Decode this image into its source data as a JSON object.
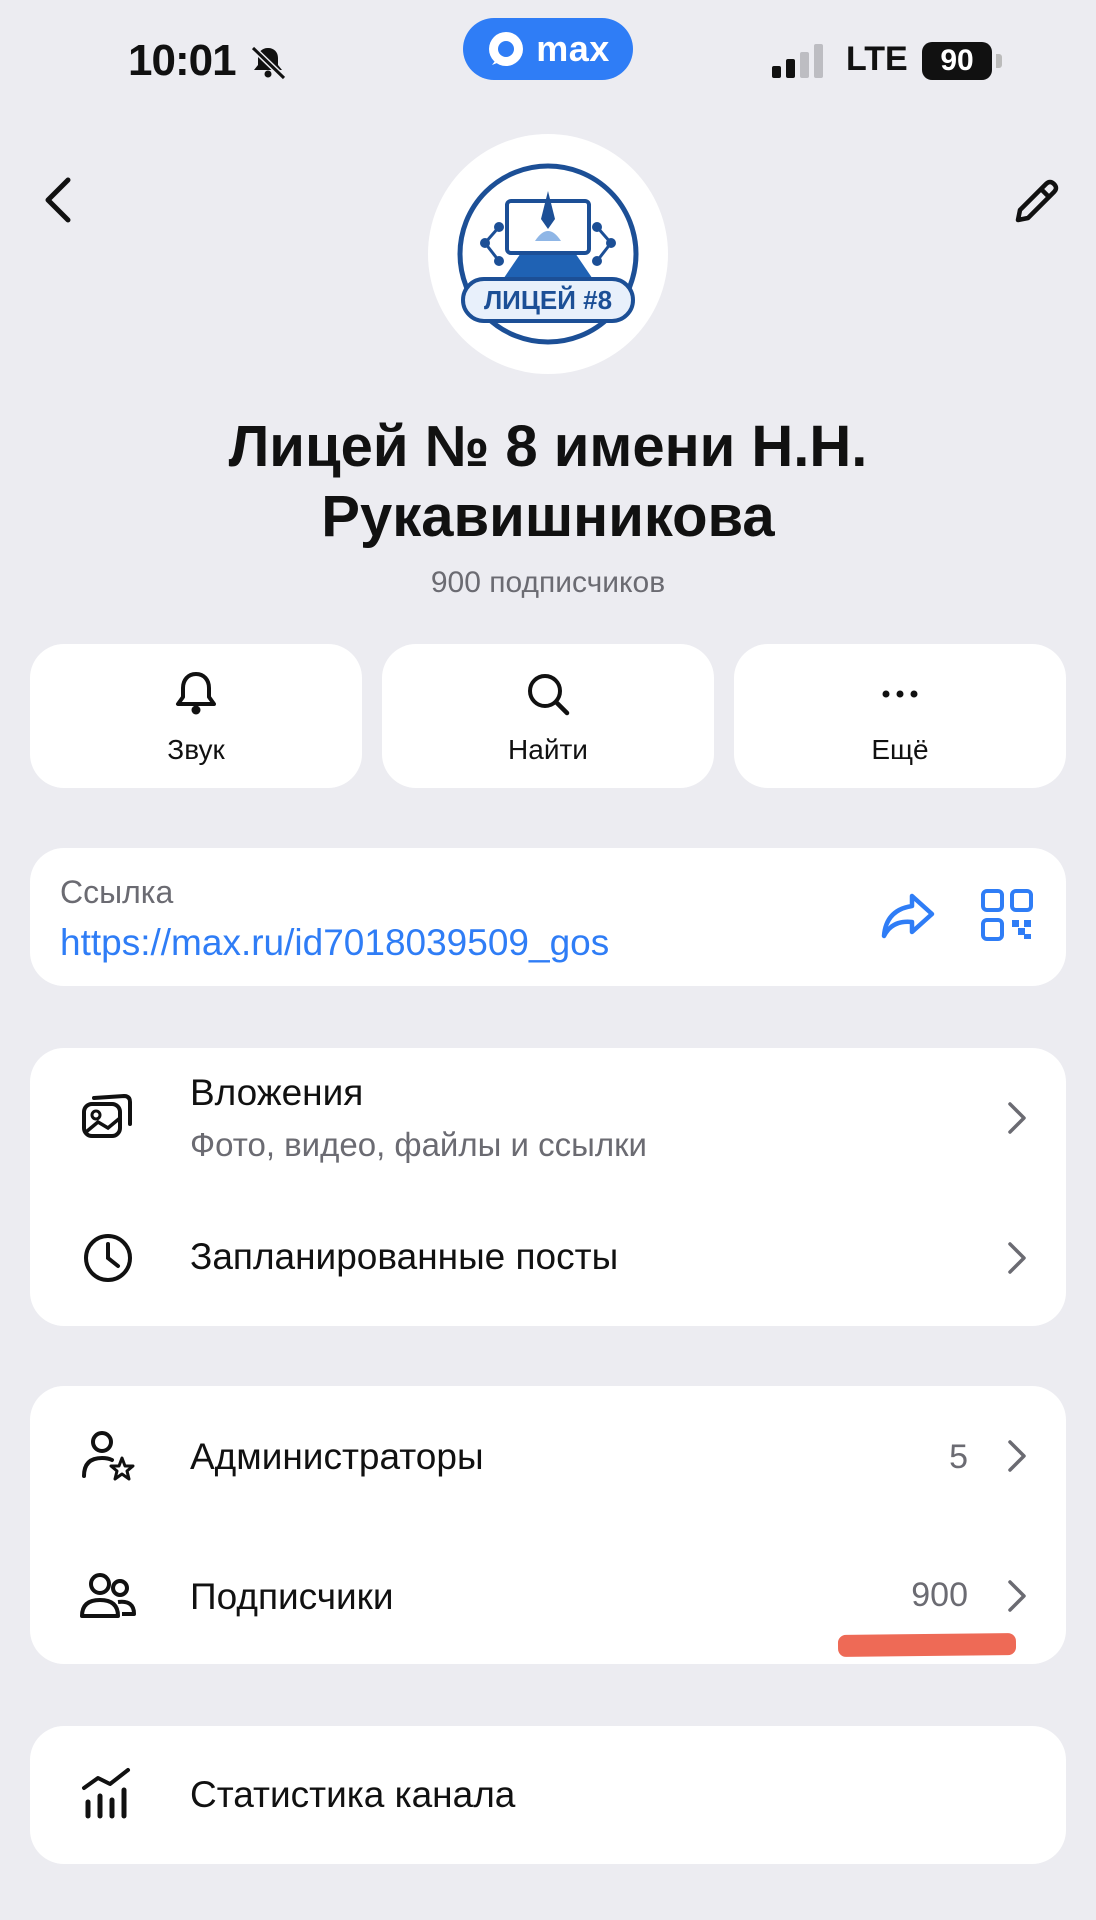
{
  "status_bar": {
    "time": "10:01",
    "network": "LTE",
    "battery": "90",
    "app_pill": "max"
  },
  "channel": {
    "title": "Лицей № 8 имени Н.Н. Рукавишникова",
    "subscribers_text": "900 подписчиков",
    "avatar_text": "ЛИЦЕЙ #8"
  },
  "actions": [
    {
      "label": "Звук",
      "icon": "bell-icon"
    },
    {
      "label": "Найти",
      "icon": "search-icon"
    },
    {
      "label": "Ещё",
      "icon": "more-icon"
    }
  ],
  "link": {
    "label": "Ссылка",
    "url": "https://max.ru/id7018039509_gos"
  },
  "content_section": [
    {
      "title": "Вложения",
      "subtitle": "Фото, видео, файлы и ссылки",
      "icon": "gallery-icon"
    },
    {
      "title": "Запланированные посты",
      "icon": "clock-icon"
    }
  ],
  "members_section": [
    {
      "title": "Администраторы",
      "count": "5",
      "icon": "admin-icon"
    },
    {
      "title": "Подписчики",
      "count": "900",
      "icon": "people-icon"
    }
  ],
  "stats_section": {
    "title": "Статистика канала",
    "icon": "chart-icon"
  },
  "colors": {
    "accent": "#2f7df6",
    "background": "#ececf1",
    "highlight": "#ee6a56"
  }
}
